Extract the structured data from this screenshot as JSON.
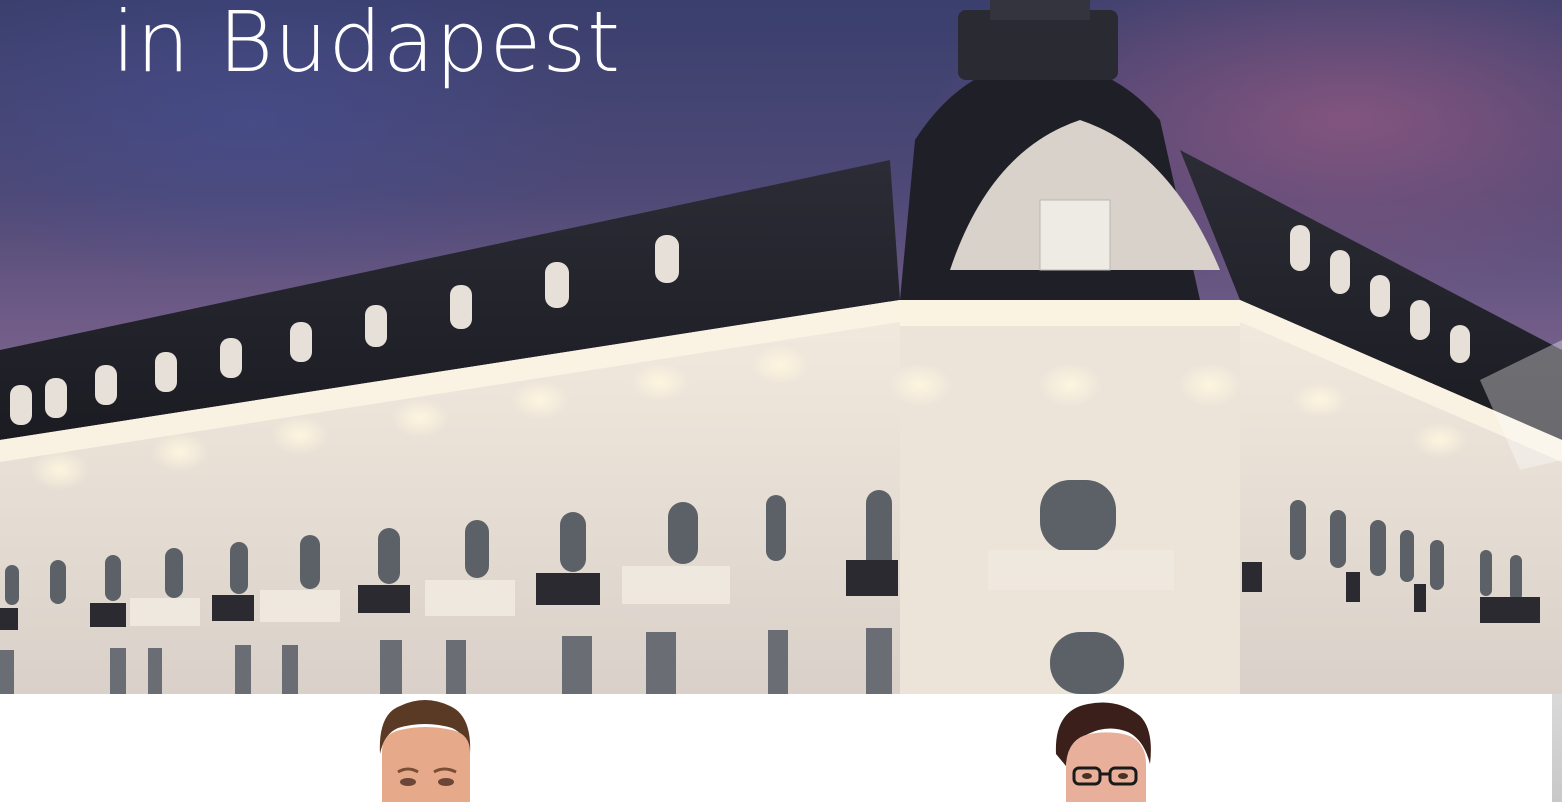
{
  "hero": {
    "title": "in Budapest",
    "image_subject": "illuminated-palace-hotel-facade-at-dusk"
  },
  "people": [
    {
      "role": "person-1",
      "icon": "man-portrait"
    },
    {
      "role": "person-2",
      "icon": "woman-with-glasses-portrait"
    }
  ],
  "colors": {
    "sky_top": "#3a3f6e",
    "sky_bottom": "#8f7f96",
    "facade": "#e9e1d6",
    "roof": "#23232b",
    "white": "#ffffff"
  }
}
